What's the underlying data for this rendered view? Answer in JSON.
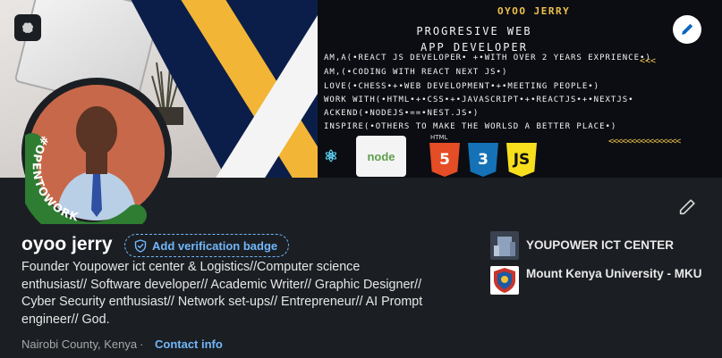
{
  "banner": {
    "brand": "OYOO JERRY",
    "title_line1": "PROGRESIVE WEB",
    "title_line2": "APP DEVELOPER",
    "lines": [
      "AM,A(•REACT JS DEVELOPER• +•WITH OVER 2 YEARS EXPRIENCE•)",
      "AM,(•CODING WITH REACT NEXT JS•)",
      "LOVE(•CHESS•+•WEB DEVELOPMENT•+•MEETING PEOPLE•)",
      "WORK WITH(•HTML•+•CSS•+•JAVASCRIPT•+•REACTJS•+•NEXTJS•",
      "ACKEND(•NODEJS•==•NEST.JS•)",
      "INSPIRE(•OTHERS TO MAKE THE WORLSD A BETTER PLACE•)"
    ],
    "chevrons": "<<<<<<<<<<<<<<<<",
    "chevrons_top": "<<<",
    "node_label": "node",
    "html_label": "HTML",
    "html_num": "5",
    "css_num": "3",
    "js_label": "JS"
  },
  "avatar": {
    "badge_text": "#OPENTOWORK"
  },
  "profile": {
    "name": "oyoo jerry",
    "verification_label": "Add verification badge",
    "headline": "Founder Youpower ict center & Logistics//Computer science enthusiast// Software developer// Academic Writer// Graphic Designer// Cyber Security enthusiast// Network set-ups// Entrepreneur// AI Prompt engineer// God.",
    "location": "Nairobi County, Kenya",
    "separator": "·",
    "contact_label": "Contact info"
  },
  "organizations": [
    {
      "name": "YOUPOWER ICT CENTER"
    },
    {
      "name": "Mount Kenya University - MKU"
    }
  ],
  "colors": {
    "background": "#1b1f23",
    "link": "#71b7fb",
    "otw_green": "#2e7d32",
    "banner_yellow": "#f2b535"
  },
  "icons": {
    "banner_left": "brain-icon",
    "banner_edit": "pencil-icon",
    "profile_edit": "pencil-icon",
    "verify": "shield-check-icon"
  }
}
